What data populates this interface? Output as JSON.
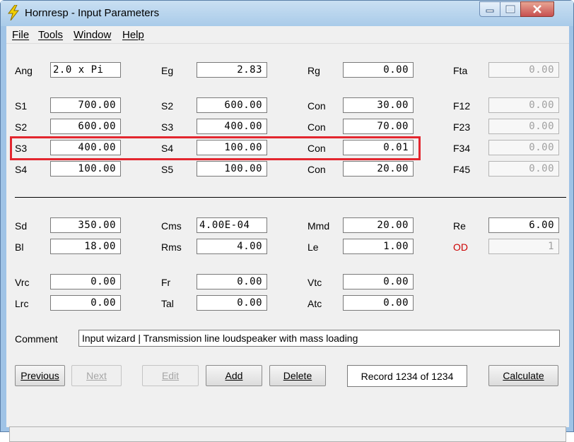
{
  "window": {
    "title": "Hornresp - Input Parameters",
    "accent_color": "#a9cbe9",
    "icon": "lightning-bolt-icon"
  },
  "menu": [
    {
      "label": "File"
    },
    {
      "label": "Tools"
    },
    {
      "label": "Window"
    },
    {
      "label": "Help"
    }
  ],
  "params": {
    "ang": {
      "label": "Ang",
      "value": "2.0 x Pi"
    },
    "eg": {
      "label": "Eg",
      "value": "2.83"
    },
    "rg": {
      "label": "Rg",
      "value": "0.00"
    },
    "fta": {
      "label": "Fta",
      "value": "0.00"
    },
    "rows": [
      {
        "s_label": "S1",
        "s_value": "700.00",
        "t_label": "S2",
        "t_value": "600.00",
        "con_label": "Con",
        "con_value": "30.00",
        "f_label": "F12",
        "f_value": "0.00"
      },
      {
        "s_label": "S2",
        "s_value": "600.00",
        "t_label": "S3",
        "t_value": "400.00",
        "con_label": "Con",
        "con_value": "70.00",
        "f_label": "F23",
        "f_value": "0.00"
      },
      {
        "s_label": "S3",
        "s_value": "400.00",
        "t_label": "S4",
        "t_value": "100.00",
        "con_label": "Con",
        "con_value": "0.01",
        "f_label": "F34",
        "f_value": "0.00"
      },
      {
        "s_label": "S4",
        "s_value": "100.00",
        "t_label": "S5",
        "t_value": "100.00",
        "con_label": "Con",
        "con_value": "20.00",
        "f_label": "F45",
        "f_value": "0.00"
      }
    ],
    "driver": {
      "sd": {
        "label": "Sd",
        "value": "350.00"
      },
      "cms": {
        "label": "Cms",
        "value": "4.00E-04"
      },
      "mmd": {
        "label": "Mmd",
        "value": "20.00"
      },
      "re": {
        "label": "Re",
        "value": "6.00"
      },
      "bl": {
        "label": "Bl",
        "value": "18.00"
      },
      "rms": {
        "label": "Rms",
        "value": "4.00"
      },
      "le": {
        "label": "Le",
        "value": "1.00"
      },
      "od": {
        "label": "OD",
        "value": "1",
        "label_color": "#cc0000"
      }
    },
    "chamber": {
      "vrc": {
        "label": "Vrc",
        "value": "0.00"
      },
      "fr": {
        "label": "Fr",
        "value": "0.00"
      },
      "vtc": {
        "label": "Vtc",
        "value": "0.00"
      },
      "lrc": {
        "label": "Lrc",
        "value": "0.00"
      },
      "tal": {
        "label": "Tal",
        "value": "0.00"
      },
      "atc": {
        "label": "Atc",
        "value": "0.00"
      }
    }
  },
  "comment": {
    "label": "Comment",
    "value": "Input wizard | Transmission line loudspeaker with mass loading"
  },
  "buttons": {
    "previous": "Previous",
    "next": "Next",
    "edit": "Edit",
    "add": "Add",
    "delete": "Delete",
    "record": "Record 1234 of 1234",
    "calculate": "Calculate"
  },
  "highlight_color": "#e3262f"
}
